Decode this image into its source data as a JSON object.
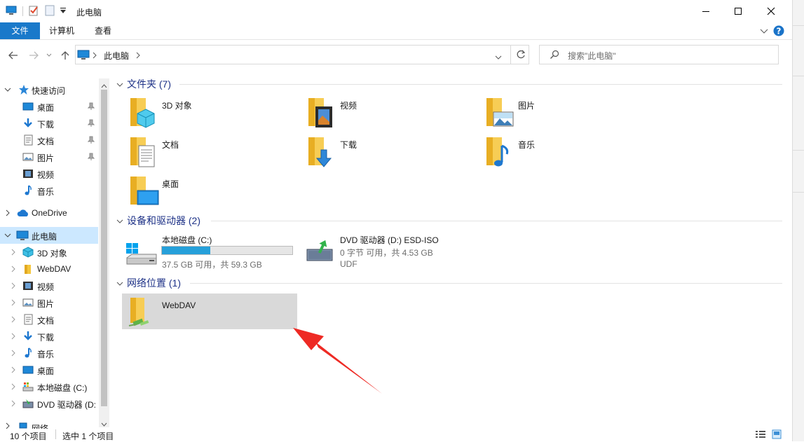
{
  "window": {
    "title": "此电脑"
  },
  "ribbon": {
    "tabs": [
      "文件",
      "计算机",
      "查看"
    ]
  },
  "address": {
    "path": "此电脑",
    "search_placeholder": "搜索\"此电脑\""
  },
  "nav": {
    "quick_access": "快速访问",
    "quick_items": [
      "桌面",
      "下载",
      "文档",
      "图片",
      "视频",
      "音乐"
    ],
    "onedrive": "OneDrive",
    "this_pc": "此电脑",
    "pc_items": [
      "3D 对象",
      "WebDAV",
      "视频",
      "图片",
      "文档",
      "下载",
      "音乐",
      "桌面",
      "本地磁盘 (C:)",
      "DVD 驱动器 (D:"
    ],
    "network": "网络"
  },
  "groups": {
    "folders": {
      "title": "文件夹 (7)",
      "items": [
        "3D 对象",
        "视频",
        "图片",
        "文档",
        "下载",
        "音乐",
        "桌面"
      ]
    },
    "devices": {
      "title": "设备和驱动器 (2)",
      "c": {
        "name": "本地磁盘 (C:)",
        "info": "37.5 GB 可用，共 59.3 GB",
        "used_fraction": 0.37
      },
      "d": {
        "name": "DVD 驱动器 (D:) ESD-ISO",
        "info": "0 字节 可用，共 4.53 GB",
        "fs": "UDF"
      }
    },
    "network": {
      "title": "网络位置 (1)",
      "item": "WebDAV"
    }
  },
  "status": {
    "count": "10 个项目",
    "selected": "选中 1 个项目"
  },
  "colors": {
    "accent": "#1979ca",
    "annotation": "#ee2a24",
    "selection": "#d9d9d9"
  }
}
